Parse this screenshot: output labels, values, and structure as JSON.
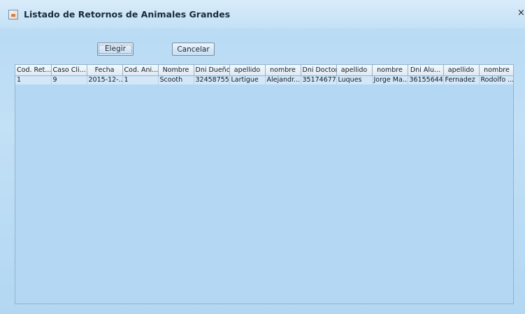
{
  "window": {
    "title": "Listado de Retornos de Animales Grandes",
    "close_glyph": "×"
  },
  "buttons": {
    "elegir": "Elegir",
    "cancelar": "Cancelar"
  },
  "table": {
    "headers": [
      "Cod. Ret...",
      "Caso Cli...",
      "Fecha",
      "Cod. Ani...",
      "Nombre",
      "Dni Dueño",
      "apellido",
      "nombre",
      "Dni Doctor",
      "apellido",
      "nombre",
      "Dni Alu...",
      "apellido",
      "nombre"
    ],
    "rows": [
      [
        "1",
        "9",
        "2015-12-...",
        "1",
        "Scooth",
        "32458755",
        "Lartigue",
        "Alejandr...",
        "35174677",
        "Luques",
        "Jorge Ma...",
        "36155644",
        "Fernadez",
        "Rodolfo ..."
      ]
    ]
  },
  "colors": {
    "window_bg": "#b9dbf4",
    "header_bg": "#dfeaf4",
    "row_bg": "#d3e7f8"
  },
  "icons": {
    "app": "java-app-icon",
    "close": "close-icon"
  }
}
